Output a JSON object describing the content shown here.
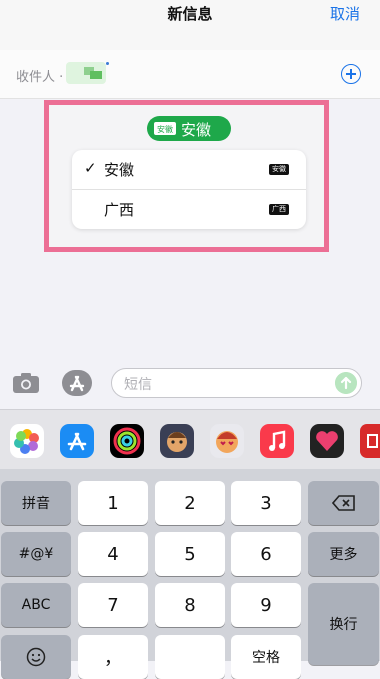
{
  "header": {
    "title": "新信息",
    "cancel_label": "取消"
  },
  "recipient": {
    "label": "收件人 ·"
  },
  "sim_picker": {
    "selected_pill": {
      "badge": "安徽",
      "label": "安徽"
    },
    "options": [
      {
        "label": "安徽",
        "checked": true,
        "badge": "安徽"
      },
      {
        "label": "广西",
        "checked": false,
        "badge": "广西"
      }
    ],
    "check_mark": "✓"
  },
  "compose": {
    "placeholder": "短信"
  },
  "app_strip": [
    {
      "name": "photos-app-icon"
    },
    {
      "name": "app-store-app-icon"
    },
    {
      "name": "activity-app-icon"
    },
    {
      "name": "memoji-app-icon"
    },
    {
      "name": "memoji-stickers-app-icon"
    },
    {
      "name": "music-app-icon"
    },
    {
      "name": "digital-touch-app-icon"
    }
  ],
  "keyboard": {
    "pinyin": "拼音",
    "symbols": "#@¥",
    "abc": "ABC",
    "more": "更多",
    "return": "换行",
    "space": "空格",
    "digits": [
      "1",
      "2",
      "3",
      "4",
      "5",
      "6",
      "7",
      "8",
      "9"
    ],
    "punct": "，"
  },
  "colors": {
    "accent": "#1a73e8",
    "sim_green": "#1ea84a",
    "highlight": "#ec6f95"
  }
}
